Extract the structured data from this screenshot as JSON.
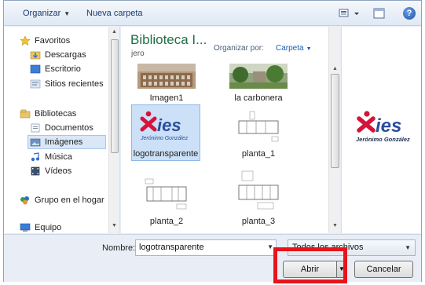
{
  "toolbar": {
    "organize_label": "Organizar",
    "new_folder_label": "Nueva carpeta",
    "help_icon": "?"
  },
  "navigation": {
    "favorites_label": "Favoritos",
    "downloads_label": "Descargas",
    "desktop_label": "Escritorio",
    "recent_label": "Sitios recientes",
    "libraries_label": "Bibliotecas",
    "documents_label": "Documentos",
    "images_label": "Imágenes",
    "music_label": "Música",
    "videos_label": "Vídeos",
    "homegroup_label": "Grupo en el hogar",
    "computer_label": "Equipo"
  },
  "library": {
    "title": "Biblioteca I...",
    "subtitle": "jero",
    "arrange_label": "Organizar por:",
    "arrange_value": "Carpeta"
  },
  "files": [
    {
      "name": "Imagen1"
    },
    {
      "name": "la carbonera"
    },
    {
      "name": "logotransparente"
    },
    {
      "name": "planta_1"
    },
    {
      "name": "planta_2"
    },
    {
      "name": "planta_3"
    }
  ],
  "logo": {
    "big_text": "ies",
    "small_text": "Jerónimo González",
    "preview_small_text": "Jerónimo González"
  },
  "footer": {
    "name_label": "Nombre:",
    "file_name_value": "logotransparente",
    "filter_value": "Todos los archivos",
    "open_label": "Abrir",
    "cancel_label": "Cancelar"
  },
  "colors": {
    "accent": "#1f6e43",
    "logo_red": "#d4143a",
    "logo_blue": "#2b4e9c",
    "highlight": "#e8141b"
  }
}
